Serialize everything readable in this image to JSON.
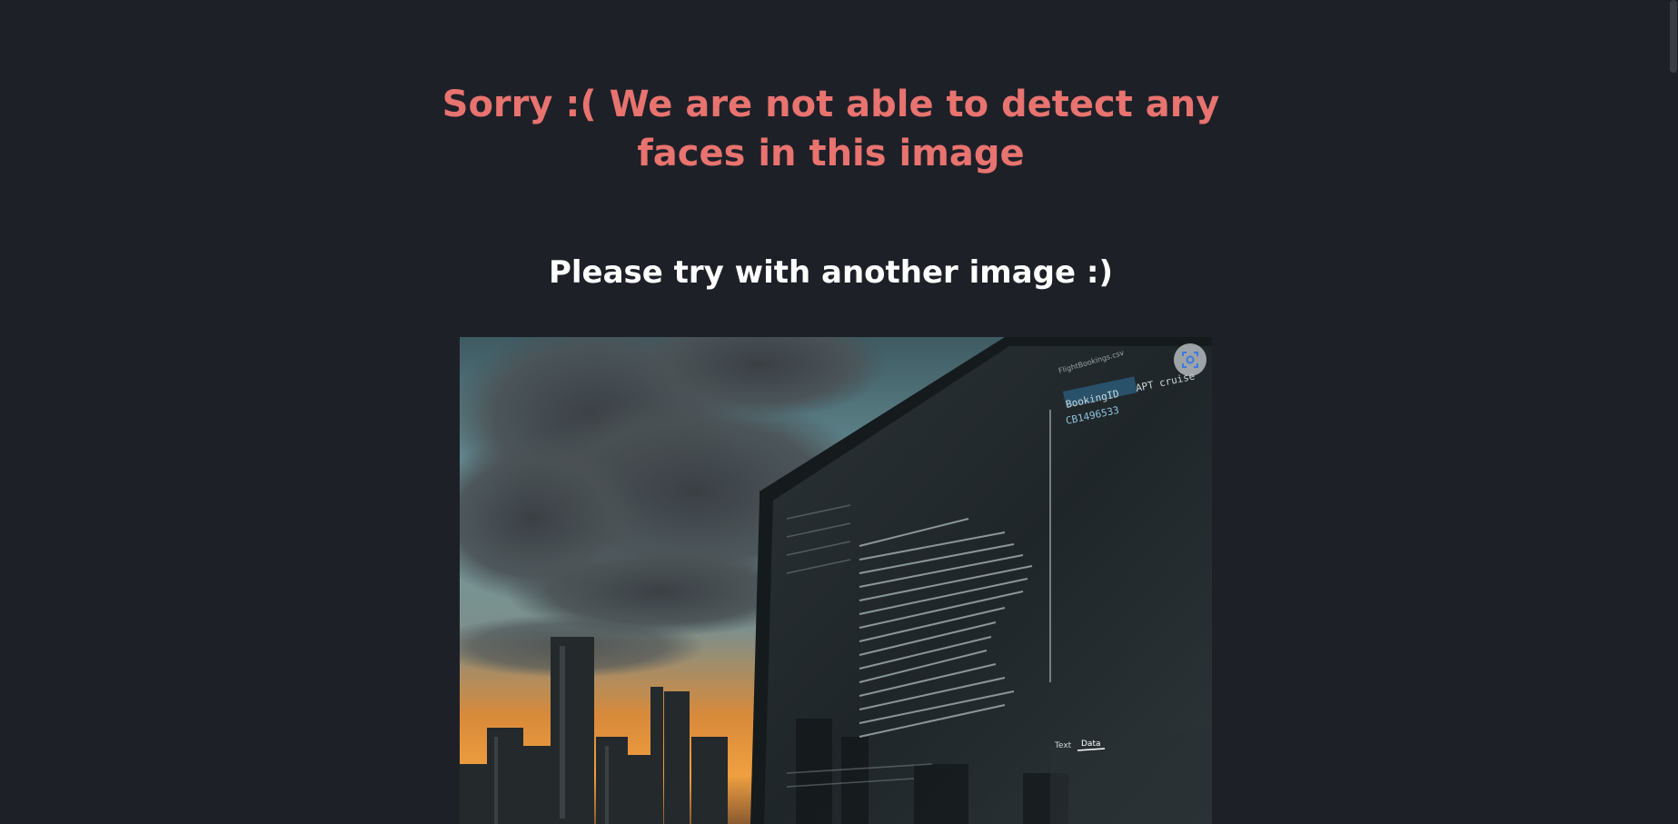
{
  "result": {
    "error_message": "Sorry :( We are not able to detect any faces in this image",
    "retry_message": "Please try with another image :)"
  },
  "uploaded_image": {
    "description_icon": "laptop-city-sunset-photo",
    "visual_search_icon": "lens-icon",
    "screen_text": {
      "booking_col": "BookingID",
      "booking_val": "CB1496533",
      "cruise_col": "APT cruise",
      "file_tab": "FlightBookings.csv",
      "tab_text": "Text",
      "tab_data": "Data"
    }
  }
}
